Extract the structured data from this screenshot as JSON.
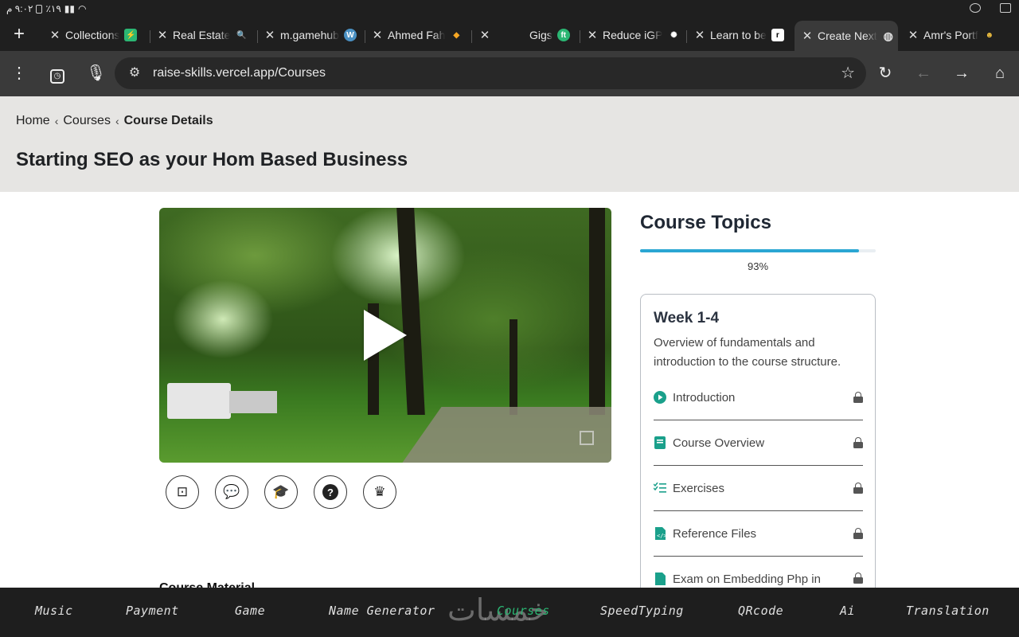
{
  "status_bar": {
    "time": "٩:٠٢ م",
    "battery": "٪١٩"
  },
  "browser": {
    "tabs": [
      {
        "title": "Collections",
        "favicon": "green-bolt-icon",
        "color": "#2bb673"
      },
      {
        "title": "Real Estate",
        "favicon": "search-emoji-icon",
        "color": "#7a5cff"
      },
      {
        "title": "m.gamehub",
        "favicon": "wordpress-icon",
        "color": "#4a90c2"
      },
      {
        "title": "Ahmed Fah",
        "favicon": "orange-logo-icon",
        "color": "#f5a623"
      },
      {
        "title": "",
        "favicon": "",
        "color": ""
      },
      {
        "title": "Gigs",
        "favicon": "ft-logo-icon",
        "color": "#2bb673"
      },
      {
        "title": "Reduce iGP",
        "favicon": "openai-icon",
        "color": "#333333"
      },
      {
        "title": "Learn to be",
        "favicon": "r-logo-icon",
        "color": "#000000"
      },
      {
        "title": "Create Next",
        "favicon": "globe-icon",
        "color": "#666666"
      },
      {
        "title": "Amr's Portf",
        "favicon": "avatar-emoji-icon",
        "color": "#f0c040"
      }
    ],
    "url": "raise-skills.vercel.app/Courses"
  },
  "breadcrumb": {
    "home": "Home",
    "courses": "Courses",
    "current": "Course Details"
  },
  "page_title": "Starting SEO as your Hom Based Business",
  "course_material_label": "Course Material",
  "sidebar": {
    "title": "Course Topics",
    "progress_percent": 93,
    "progress_label": "93%",
    "week": {
      "title": "Week 1-4",
      "description": "Overview of fundamentals and introduction to the course structure.",
      "topics": [
        {
          "label": "Introduction",
          "icon": "play-circle-icon"
        },
        {
          "label": "Course Overview",
          "icon": "book-icon"
        },
        {
          "label": "Exercises",
          "icon": "checklist-icon"
        },
        {
          "label": "Reference Files",
          "icon": "code-file-icon"
        },
        {
          "label": "Exam on Embedding Php in",
          "icon": "file-icon"
        }
      ]
    }
  },
  "actions": [
    {
      "icon": "teacher-icon",
      "glyph": "🧑‍🏫"
    },
    {
      "icon": "chat-icon",
      "glyph": "💬"
    },
    {
      "icon": "graduation-cap-icon",
      "glyph": "🎓"
    },
    {
      "icon": "help-icon",
      "glyph": "?"
    },
    {
      "icon": "crown-icon",
      "glyph": "♛"
    }
  ],
  "bottom_nav": {
    "items": [
      "Music",
      "Payment",
      "Game",
      "Name Generator",
      "Courses",
      "SpeedTyping",
      "QRcode",
      "Ai",
      "Translation"
    ],
    "active": "Courses",
    "active_color": "#2bb673",
    "watermark": "خمسات"
  }
}
